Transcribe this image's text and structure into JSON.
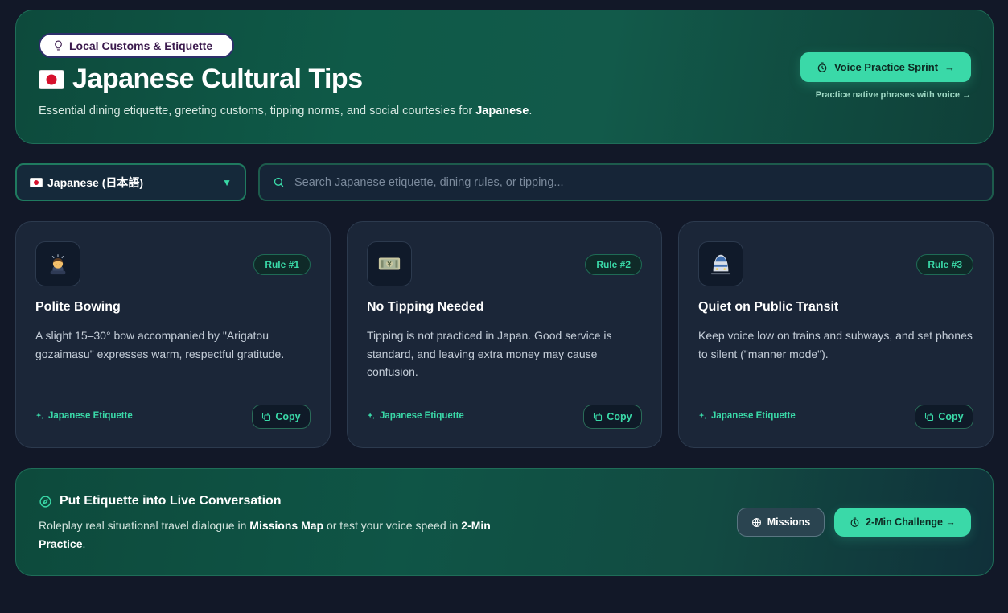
{
  "hero": {
    "badge_icon": "lightbulb-icon",
    "badge_label": "Local Customs & Etiquette",
    "flag_icon": "japan-flag-icon",
    "title": "Japanese Cultural Tips",
    "subtitle_prefix": "Essential dining etiquette, greeting customs, tipping norms, and social courtesies for ",
    "subtitle_language": "Japanese",
    "subtitle_suffix": ".",
    "voice_button_label": "Voice Practice Sprint",
    "voice_button_arrow": "→",
    "voice_hint": "Practice native phrases with voice →"
  },
  "language_select": {
    "selected": "Japanese (日本語)",
    "caret": "▼"
  },
  "search": {
    "placeholder": "Search Japanese etiquette, dining rules, or tipping..."
  },
  "cards": [
    {
      "icon": "bowing-person-icon",
      "rule_label": "Rule #1",
      "title": "Polite Bowing",
      "description": "A slight 15–30° bow accompanied by \"Arigatou gozaimasu\" expresses warm, respectful gratitude.",
      "tag": "Japanese Etiquette",
      "copy_label": "Copy"
    },
    {
      "icon": "yen-banknote-icon",
      "rule_label": "Rule #2",
      "title": "No Tipping Needed",
      "description": "Tipping is not practiced in Japan. Good service is standard, and leaving extra money may cause confusion.",
      "tag": "Japanese Etiquette",
      "copy_label": "Copy"
    },
    {
      "icon": "train-icon",
      "rule_label": "Rule #3",
      "title": "Quiet on Public Transit",
      "description": "Keep voice low on trains and subways, and set phones to silent (\"manner mode\").",
      "tag": "Japanese Etiquette",
      "copy_label": "Copy"
    }
  ],
  "cta": {
    "title": "Put Etiquette into Live Conversation",
    "desc_1": "Roleplay real situational travel dialogue in ",
    "desc_missions": "Missions Map",
    "desc_2": " or test your voice speed in ",
    "desc_practice": "2-Min Practice",
    "desc_3": ".",
    "missions_label": "Missions",
    "challenge_label": "2-Min Challenge →"
  },
  "colors": {
    "accent": "#3ad9a8",
    "background": "#121828",
    "card": "#1b2638",
    "hero_gradient": "#0f5a48"
  }
}
